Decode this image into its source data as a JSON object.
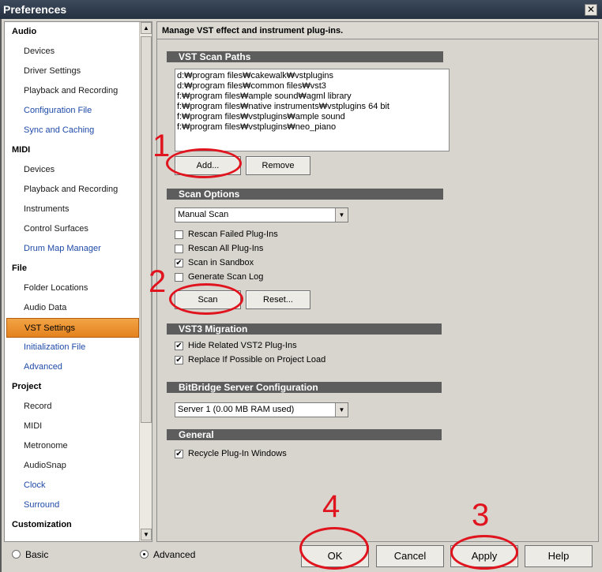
{
  "window": {
    "title": "Preferences",
    "close_glyph": "✕"
  },
  "sidebar": {
    "items": [
      {
        "label": "Audio",
        "type": "cat"
      },
      {
        "label": "Devices",
        "type": "item"
      },
      {
        "label": "Driver Settings",
        "type": "item"
      },
      {
        "label": "Playback and Recording",
        "type": "item"
      },
      {
        "label": "Configuration File",
        "type": "link"
      },
      {
        "label": "Sync and Caching",
        "type": "link"
      },
      {
        "label": "MIDI",
        "type": "cat"
      },
      {
        "label": "Devices",
        "type": "item"
      },
      {
        "label": "Playback and Recording",
        "type": "item"
      },
      {
        "label": "Instruments",
        "type": "item"
      },
      {
        "label": "Control Surfaces",
        "type": "item"
      },
      {
        "label": "Drum Map Manager",
        "type": "link"
      },
      {
        "label": "File",
        "type": "cat"
      },
      {
        "label": "Folder Locations",
        "type": "item"
      },
      {
        "label": "Audio Data",
        "type": "item"
      },
      {
        "label": "VST Settings",
        "type": "selected"
      },
      {
        "label": "Initialization File",
        "type": "link"
      },
      {
        "label": "Advanced",
        "type": "link"
      },
      {
        "label": "Project",
        "type": "cat"
      },
      {
        "label": "Record",
        "type": "item"
      },
      {
        "label": "MIDI",
        "type": "item"
      },
      {
        "label": "Metronome",
        "type": "item"
      },
      {
        "label": "AudioSnap",
        "type": "item"
      },
      {
        "label": "Clock",
        "type": "link"
      },
      {
        "label": "Surround",
        "type": "link"
      },
      {
        "label": "Customization",
        "type": "cat"
      }
    ]
  },
  "main": {
    "header": "Manage VST effect and instrument plug-ins.",
    "scan_paths": {
      "title": "VST Scan Paths",
      "paths": [
        "d:₩program files₩cakewalk₩vstplugins",
        "d:₩program files₩common files₩vst3",
        "f:₩program files₩ample sound₩agml library",
        "f:₩program files₩native instruments₩vstplugins 64 bit",
        "f:₩program files₩vstplugins₩ample sound",
        "f:₩program files₩vstplugins₩neo_piano"
      ],
      "add_label": "Add...",
      "remove_label": "Remove"
    },
    "scan_options": {
      "title": "Scan Options",
      "mode": "Manual Scan",
      "checks": [
        {
          "label": "Rescan Failed Plug-Ins",
          "checked": false
        },
        {
          "label": "Rescan All Plug-Ins",
          "checked": false
        },
        {
          "label": "Scan in Sandbox",
          "checked": true
        },
        {
          "label": "Generate Scan Log",
          "checked": false
        }
      ],
      "scan_label": "Scan",
      "reset_label": "Reset..."
    },
    "vst3": {
      "title": "VST3 Migration",
      "checks": [
        {
          "label": "Hide Related VST2 Plug-Ins",
          "checked": true
        },
        {
          "label": "Replace If Possible on Project Load",
          "checked": true
        }
      ]
    },
    "bitbridge": {
      "title": "BitBridge Server Configuration",
      "server": "Server 1  (0.00  MB RAM used)"
    },
    "general": {
      "title": "General",
      "checks": [
        {
          "label": "Recycle Plug-In Windows",
          "checked": true
        }
      ]
    }
  },
  "footer": {
    "basic_label": "Basic",
    "advanced_label": "Advanced",
    "selected_mode": "Advanced",
    "ok_label": "OK",
    "cancel_label": "Cancel",
    "apply_label": "Apply",
    "help_label": "Help"
  },
  "annotations": {
    "n1": "1",
    "n2": "2",
    "n3": "3",
    "n4": "4"
  },
  "colors": {
    "selected_item": "#e4821f",
    "link_text": "#1f4aa8",
    "annotation": "#e0141e",
    "section_bar": "#5d5d5d"
  }
}
